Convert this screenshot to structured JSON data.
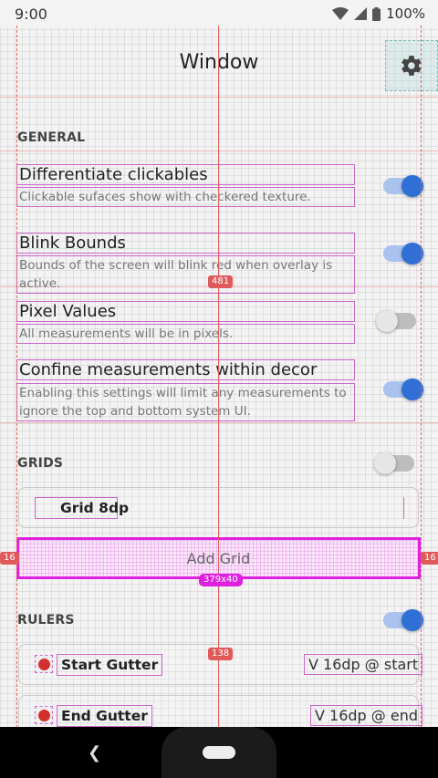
{
  "status_bar": {
    "time": "9:00",
    "battery": "100%"
  },
  "toolbar": {
    "title": "Window",
    "settings_icon": "gear-icon"
  },
  "sections": {
    "general": "GENERAL",
    "grids": "GRIDS",
    "rulers": "RULERS"
  },
  "settings": [
    {
      "title": "Differentiate clickables",
      "description": "Clickable sufaces show with checkered texture.",
      "enabled": true
    },
    {
      "title": "Blink Bounds",
      "description": "Bounds of the screen will blink red when overlay is active.",
      "enabled": true
    },
    {
      "title": "Pixel Values",
      "description": "All measurements will be in pixels.",
      "enabled": false
    },
    {
      "title": "Confine measurements within decor",
      "description": "Enabling this settings will limit any measurements to ignore the top and bottom system UI.",
      "enabled": true
    }
  ],
  "grids": {
    "enabled": false,
    "item_label": "Grid 8dp",
    "add_label": "Add Grid"
  },
  "rulers": {
    "enabled": true,
    "items": [
      {
        "label": "Start Gutter",
        "value": "V 16dp @ start"
      },
      {
        "label": "End Gutter",
        "value": "V 16dp @ end"
      }
    ]
  },
  "overlay": {
    "badge_top": "481",
    "badge_left": "16",
    "badge_right": "16",
    "badge_size": "379x40",
    "badge_bottom": "138"
  },
  "nav": {
    "back_icon": "back-icon",
    "home": "home-button"
  },
  "colors": {
    "accent": "#2f6fd6",
    "highlight": "#e020e0",
    "guide": "#e06060",
    "dot": "#d32f2f"
  }
}
